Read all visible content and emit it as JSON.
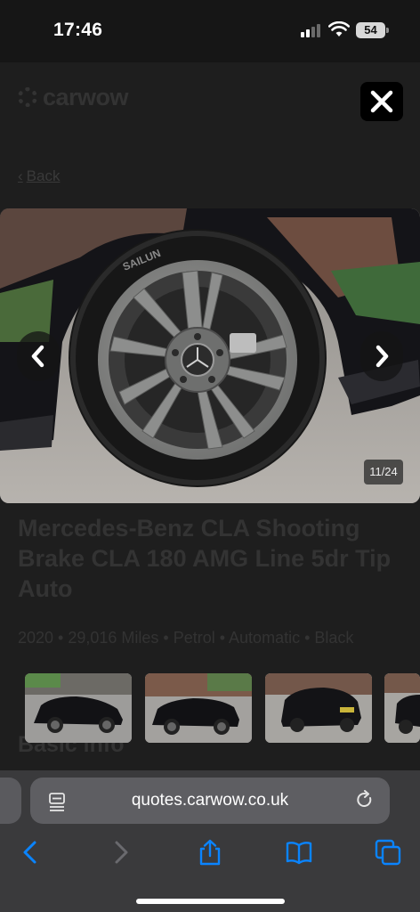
{
  "status_bar": {
    "time": "17:46",
    "battery": "54"
  },
  "page": {
    "logo": "carwow",
    "back_label": "Back",
    "title": "Mercedes-Benz CLA Shooting Brake CLA 180 AMG Line 5dr Tip Auto",
    "specs": "2020 • 29,016 Miles • Petrol • Automatic • Black",
    "section_heading": "Basic info"
  },
  "gallery": {
    "counter": "11/24",
    "tyre_brand": "SAILUN",
    "thumbnail_count": 4
  },
  "browser": {
    "url": "quotes.carwow.co.uk"
  },
  "icons": {
    "close": "close-icon",
    "prev": "chevron-left-icon",
    "next": "chevron-right-icon",
    "reader": "reader-icon",
    "reload": "reload-icon",
    "back": "browser-back-icon",
    "forward": "browser-forward-icon",
    "share": "share-icon",
    "bookmarks": "bookmarks-icon",
    "tabs": "tabs-icon"
  },
  "colors": {
    "accent": "#0a84ff",
    "overlay": "#1e1e1e",
    "toolbar": "#3a3a3c"
  }
}
